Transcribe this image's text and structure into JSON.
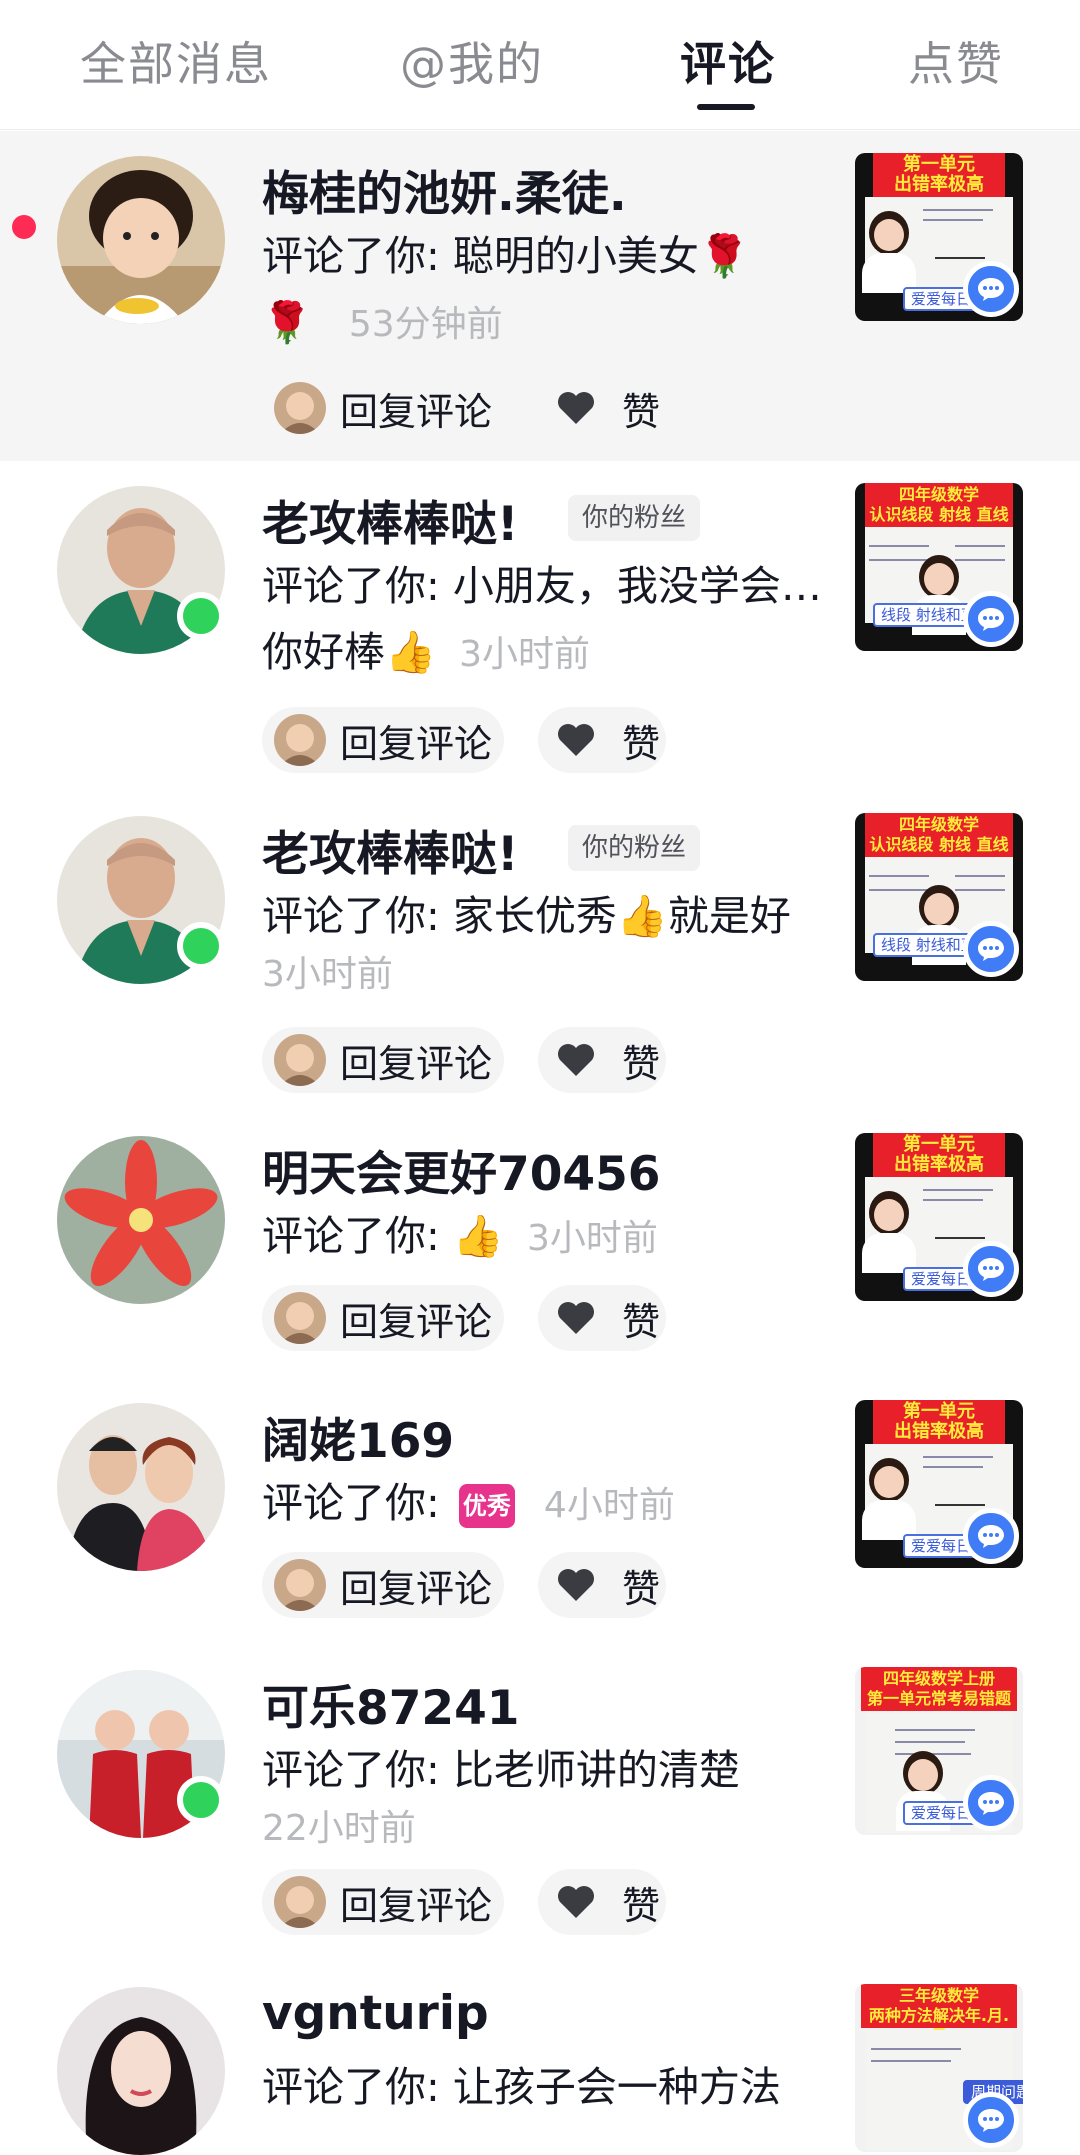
{
  "tabs": [
    {
      "label": "全部消息",
      "active": false
    },
    {
      "label": "@我的",
      "active": false
    },
    {
      "label": "评论",
      "active": true
    },
    {
      "label": "点赞",
      "active": false
    }
  ],
  "actions": {
    "reply_label": "回复评论",
    "like_label": "赞"
  },
  "colors": {
    "accent": "#161823",
    "unread_dot": "#fe2c55",
    "online": "#2fd35c",
    "comment_bubble": "#3f7cf6"
  },
  "items": [
    {
      "name": "梅桂的池妍.柔徒.",
      "unread": true,
      "online": false,
      "fan_badge": "",
      "comment": "评论了你: 聪明的小美女🌹",
      "comment_tail": "🌹",
      "time": "53分钟前",
      "thumb": {
        "banner_1": "第一单元",
        "banner_2": "出错率极高",
        "caption": "爱爱每日一"
      }
    },
    {
      "name": "老攻棒棒哒!",
      "unread": false,
      "online": true,
      "fan_badge": "你的粉丝",
      "comment": "评论了你: 小朋友，我没学会…你好棒👍",
      "time": "3小时前",
      "thumb": {
        "banner_1": "四年级数学",
        "banner_2": "认识线段 射线 直线",
        "caption": "线段 射线和直线"
      }
    },
    {
      "name": "老攻棒棒哒!",
      "unread": false,
      "online": true,
      "fan_badge": "你的粉丝",
      "comment": "评论了你: 家长优秀👍就是好",
      "time": "3小时前",
      "thumb": {
        "banner_1": "四年级数学",
        "banner_2": "认识线段 射线 直线",
        "caption": "线段 射线和直线"
      }
    },
    {
      "name": "明天会更好70456",
      "unread": false,
      "online": false,
      "fan_badge": "",
      "comment": "评论了你: 👍",
      "time": "3小时前",
      "thumb": {
        "banner_1": "第一单元",
        "banner_2": "出错率极高",
        "caption": "爱爱每日一"
      }
    },
    {
      "name": "阔姥169",
      "unread": false,
      "online": false,
      "fan_badge": "",
      "comment": "评论了你:",
      "sticker": "优秀",
      "time": "4小时前",
      "thumb": {
        "banner_1": "第一单元",
        "banner_2": "出错率极高",
        "caption": "爱爱每日一"
      }
    },
    {
      "name": "可乐87241",
      "unread": false,
      "online": true,
      "fan_badge": "",
      "comment": "评论了你: 比老师讲的清楚",
      "time": "22小时前",
      "thumb": {
        "banner_1": "四年级数学上册",
        "banner_2": "第一单元常考易错题",
        "caption": "爱爱每日一"
      }
    },
    {
      "name": "vgnturip",
      "unread": false,
      "online": false,
      "fan_badge": "",
      "comment": "评论了你: 让孩子会一种方法",
      "time": "",
      "thumb": {
        "banner_1": "三年级数学",
        "banner_2": "两种方法解决年.月.日",
        "caption": "周期问题"
      }
    }
  ]
}
